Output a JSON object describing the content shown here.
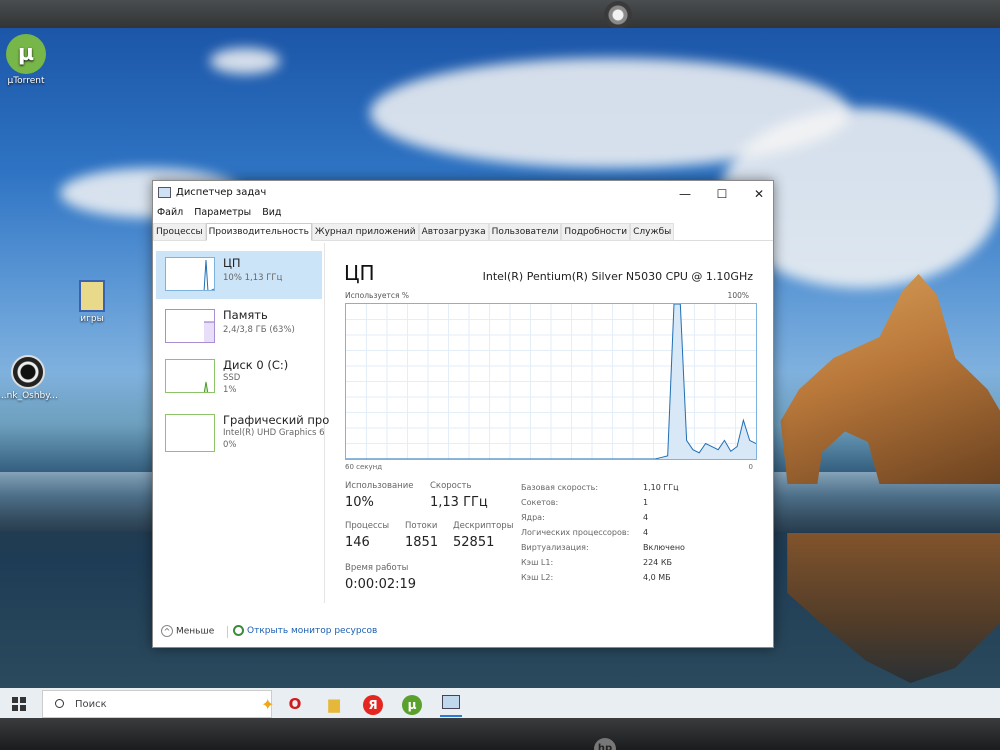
{
  "desktop": {
    "icons": [
      {
        "label": "µTorrent"
      },
      {
        "label": "игры"
      },
      {
        "label": "...nk_Oshby..."
      }
    ]
  },
  "window": {
    "title": "Диспетчер задач",
    "controls": {
      "minimize": "—",
      "maximize": "☐",
      "close": "✕"
    },
    "menu": [
      "Файл",
      "Параметры",
      "Вид"
    ],
    "tabs": [
      "Процессы",
      "Производительность",
      "Журнал приложений",
      "Автозагрузка",
      "Пользователи",
      "Подробности",
      "Службы"
    ],
    "active_tab": "Производительность",
    "sidebar": [
      {
        "name": "ЦП",
        "sub1": "10% 1,13 ГГц",
        "sub2": ""
      },
      {
        "name": "Память",
        "sub1": "2,4/3,8 ГБ (63%)",
        "sub2": ""
      },
      {
        "name": "Диск 0 (C:)",
        "sub1": "SSD",
        "sub2": "1%"
      },
      {
        "name": "Графический про",
        "sub1": "Intel(R) UHD Graphics 6",
        "sub2": "0%"
      }
    ],
    "cpu": {
      "title": "ЦП",
      "model": "Intel(R) Pentium(R) Silver N5030 CPU @ 1.10GHz",
      "graph_label": "Используется %",
      "graph_max": "100%",
      "axis_left": "60 секунд",
      "axis_right": "0",
      "usage_history": [
        0,
        0,
        0,
        0,
        0,
        0,
        0,
        0,
        0,
        0,
        0,
        0,
        0,
        0,
        0,
        0,
        0,
        0,
        0,
        0,
        0,
        0,
        0,
        0,
        0,
        0,
        0,
        0,
        0,
        0,
        0,
        0,
        0,
        0,
        0,
        0,
        0,
        0,
        0,
        0,
        0,
        0,
        0,
        0,
        0,
        0,
        0,
        0,
        0,
        0,
        1,
        2,
        100,
        100,
        12,
        6,
        4,
        10,
        8,
        6,
        12,
        5,
        8,
        25,
        12,
        10
      ],
      "stats": {
        "usage_label": "Использование",
        "usage": "10%",
        "speed_label": "Скорость",
        "speed": "1,13 ГГц",
        "processes_label": "Процессы",
        "processes": "146",
        "threads_label": "Потоки",
        "threads": "1851",
        "handles_label": "Дескрипторы",
        "handles": "52851",
        "uptime_label": "Время работы",
        "uptime": "0:00:02:19"
      },
      "info": [
        {
          "label": "Базовая скорость:",
          "value": "1,10 ГГц"
        },
        {
          "label": "Сокетов:",
          "value": "1"
        },
        {
          "label": "Ядра:",
          "value": "4"
        },
        {
          "label": "Логических процессоров:",
          "value": "4"
        },
        {
          "label": "Виртуализация:",
          "value": "Включено"
        },
        {
          "label": "Кэш L1:",
          "value": "224 КБ"
        },
        {
          "label": "Кэш L2:",
          "value": "4,0 МБ"
        }
      ]
    },
    "footer": {
      "less": "Меньше",
      "monitor": "Открыть монитор ресурсов"
    }
  },
  "taskbar": {
    "search_placeholder": "Поиск",
    "apps": [
      "opera",
      "file-explorer",
      "yandex-browser",
      "utorrent",
      "task-manager"
    ],
    "yandex_letter": "Я",
    "utorrent_letter": "µ"
  },
  "colors": {
    "accent": "#2a7bd4",
    "graph_line": "#1f6fb5",
    "graph_fill": "#d8e8f6",
    "selection": "#cce4f7"
  }
}
